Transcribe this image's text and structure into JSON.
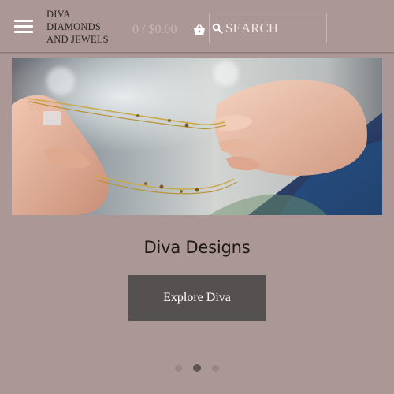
{
  "header": {
    "menu_icon": "hamburger-menu-icon",
    "logo": {
      "line1": "DIVA",
      "line2": "DIAMONDS",
      "line3": "AND JEWELS"
    },
    "cart": {
      "text": "0 / $0.00",
      "icon": "basket-icon"
    },
    "search": {
      "placeholder": "SEARCH",
      "value": "",
      "icon": "search-icon"
    }
  },
  "slideshow": {
    "slide_title": "Diva Designs",
    "button_label": "Explore Diva",
    "slide_count": 3,
    "active_slide": 2
  },
  "colors": {
    "page_background": "#ab9796",
    "button_background": "#555151",
    "active_dot": "#5d5554"
  }
}
